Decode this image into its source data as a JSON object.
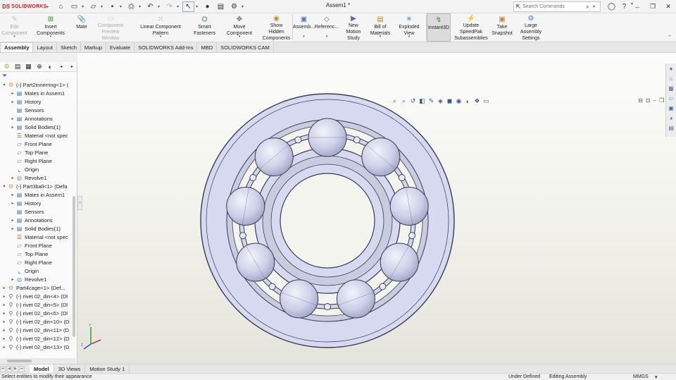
{
  "app": {
    "brand_ds": "DS",
    "brand_name": "SOLIDWORKS",
    "document_title": "Assem1 *"
  },
  "search": {
    "placeholder": "Search Commands"
  },
  "command_manager": [
    {
      "label": "Edit Component",
      "icon": "edit-component-icon",
      "disabled": true
    },
    {
      "label": "Insert Components",
      "icon": "insert-components-icon"
    },
    {
      "label": "Mate",
      "icon": "mate-icon"
    },
    {
      "label": "Component Preview Window",
      "icon": "preview-window-icon",
      "disabled": true
    },
    {
      "label": "Linear Component Pattern",
      "icon": "linear-pattern-icon"
    },
    {
      "label": "Smart Fasteners",
      "icon": "smart-fasteners-icon"
    },
    {
      "label": "Move Component",
      "icon": "move-component-icon"
    },
    {
      "label": "Show Hidden Components",
      "icon": "show-hidden-icon"
    },
    {
      "label": "Assemb...",
      "icon": "assembly-features-icon"
    },
    {
      "label": "Referenc...",
      "icon": "reference-geometry-icon"
    },
    {
      "label": "New Motion Study",
      "icon": "motion-study-icon"
    },
    {
      "label": "Bill of Materials",
      "icon": "bom-icon"
    },
    {
      "label": "Exploded View",
      "icon": "exploded-view-icon"
    },
    {
      "label": "Instant3D",
      "icon": "instant3d-icon",
      "active": true
    },
    {
      "label": "Update SpeedPak Subassemblies",
      "icon": "speedpak-icon"
    },
    {
      "label": "Take Snapshot",
      "icon": "snapshot-icon"
    },
    {
      "label": "Large Assembly Settings",
      "icon": "large-assembly-icon"
    }
  ],
  "tabs": [
    "Assembly",
    "Layout",
    "Sketch",
    "Markup",
    "Evaluate",
    "SOLIDWORKS Add-Ins",
    "MBD",
    "SOLIDWORKS CAM"
  ],
  "feature_tree": [
    {
      "level": 0,
      "twist": "▾",
      "icon": "assembly",
      "label": "(-) Part2innerring<1> ("
    },
    {
      "level": 1,
      "twist": "▸",
      "icon": "folder",
      "label": "Mates in Assem1"
    },
    {
      "level": 1,
      "twist": "▸",
      "icon": "folder",
      "label": "History"
    },
    {
      "level": 1,
      "twist": "",
      "icon": "folder",
      "label": "Sensors"
    },
    {
      "level": 1,
      "twist": "▸",
      "icon": "folder",
      "label": "Annotations"
    },
    {
      "level": 1,
      "twist": "▸",
      "icon": "folder",
      "label": "Solid Bodies(1)"
    },
    {
      "level": 1,
      "twist": "",
      "icon": "material",
      "label": "Material <not spec"
    },
    {
      "level": 1,
      "twist": "",
      "icon": "plane",
      "label": "Front Plane"
    },
    {
      "level": 1,
      "twist": "",
      "icon": "plane",
      "label": "Top Plane"
    },
    {
      "level": 1,
      "twist": "",
      "icon": "plane",
      "label": "Right Plane"
    },
    {
      "level": 1,
      "twist": "",
      "icon": "origin",
      "label": "Origin"
    },
    {
      "level": 1,
      "twist": "▸",
      "icon": "revolve",
      "label": "Revolve1"
    },
    {
      "level": 0,
      "twist": "▾",
      "icon": "assembly",
      "label": "(-) Part3ball<1> (Defa"
    },
    {
      "level": 1,
      "twist": "▸",
      "icon": "folder",
      "label": "Mates in Assem1"
    },
    {
      "level": 1,
      "twist": "▸",
      "icon": "folder",
      "label": "History"
    },
    {
      "level": 1,
      "twist": "",
      "icon": "folder",
      "label": "Sensors"
    },
    {
      "level": 1,
      "twist": "▸",
      "icon": "folder",
      "label": "Annotations"
    },
    {
      "level": 1,
      "twist": "▸",
      "icon": "folder",
      "label": "Solid Bodies(1)"
    },
    {
      "level": 1,
      "twist": "",
      "icon": "material",
      "label": "Material <not spec"
    },
    {
      "level": 1,
      "twist": "",
      "icon": "plane",
      "label": "Front Plane"
    },
    {
      "level": 1,
      "twist": "",
      "icon": "plane",
      "label": "Top Plane"
    },
    {
      "level": 1,
      "twist": "",
      "icon": "plane",
      "label": "Right Plane"
    },
    {
      "level": 1,
      "twist": "",
      "icon": "origin",
      "label": "Origin"
    },
    {
      "level": 1,
      "twist": "▸",
      "icon": "revolve",
      "label": "Revolve1"
    },
    {
      "level": 0,
      "twist": "▸",
      "icon": "assembly",
      "label": "Part4cage<1> (Def..."
    },
    {
      "level": 0,
      "twist": "▸",
      "icon": "rivet",
      "label": "(-) rivet 02_din<4> (Dl"
    },
    {
      "level": 0,
      "twist": "▸",
      "icon": "rivet",
      "label": "(-) rivet 02_din<5> (Dl"
    },
    {
      "level": 0,
      "twist": "▸",
      "icon": "rivet",
      "label": "(-) rivet 02_din<6> (Dl"
    },
    {
      "level": 0,
      "twist": "▸",
      "icon": "rivet",
      "label": "(-) rivet 02_din<10> (D"
    },
    {
      "level": 0,
      "twist": "▸",
      "icon": "rivet",
      "label": "(-) rivet 02_din<11> (D"
    },
    {
      "level": 0,
      "twist": "▸",
      "icon": "rivet",
      "label": "(-) rivet 02_din<12> (D"
    },
    {
      "level": 0,
      "twist": "▸",
      "icon": "rivet",
      "label": "(-) rivet 02_din<13> (D"
    }
  ],
  "bottom_tabs": [
    "Model",
    "3D Views",
    "Motion Study 1"
  ],
  "status": {
    "message": "Select entities to modify their appearance",
    "definition": "Under Defined",
    "mode": "Editing Assembly",
    "units": "MMGS"
  },
  "colors": {
    "part_fill": "#d6d9ef",
    "part_edge": "#3a3d52",
    "brand": "#d2232a"
  }
}
